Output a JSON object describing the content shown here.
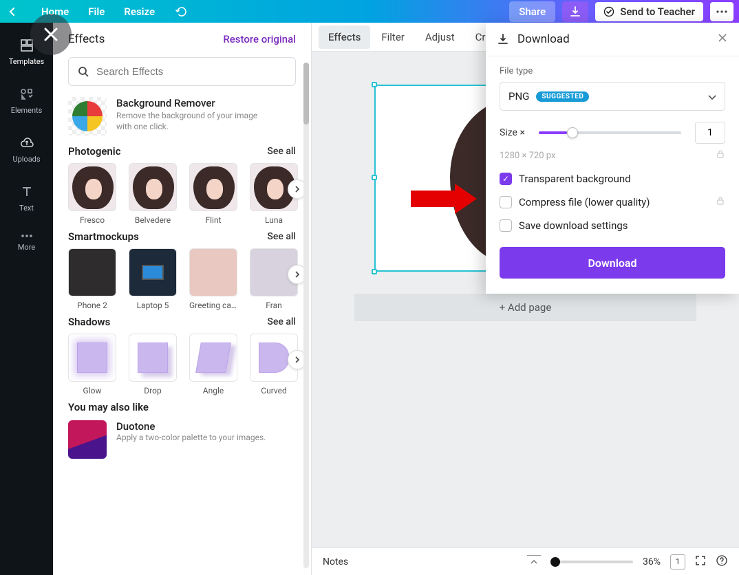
{
  "top": {
    "home": "Home",
    "file": "File",
    "resize": "Resize",
    "share": "Share",
    "send": "Send to Teacher"
  },
  "sidenav": [
    {
      "label": "Templates"
    },
    {
      "label": "Elements"
    },
    {
      "label": "Uploads"
    },
    {
      "label": "Text"
    },
    {
      "label": "More"
    }
  ],
  "panel": {
    "title": "Effects",
    "restore": "Restore original",
    "search_ph": "Search Effects",
    "bg_title": "Background Remover",
    "bg_desc": "Remove the background of your image with one click.",
    "seeall": "See all",
    "photogenic": {
      "title": "Photogenic",
      "items": [
        "Fresco",
        "Belvedere",
        "Flint",
        "Luna"
      ]
    },
    "smartmockups": {
      "title": "Smartmockups",
      "items": [
        "Phone 2",
        "Laptop 5",
        "Greeting car...",
        "Fran"
      ]
    },
    "shadows": {
      "title": "Shadows",
      "items": [
        "Glow",
        "Drop",
        "Angle",
        "Curved"
      ]
    },
    "yml_title": "You may also like",
    "duotone_title": "Duotone",
    "duotone_desc": "Apply a two-color palette to your images."
  },
  "tabs": [
    "Effects",
    "Filter",
    "Adjust",
    "Cr"
  ],
  "stage": {
    "add_page": "+ Add page"
  },
  "bottom": {
    "notes": "Notes",
    "zoom": "36%",
    "page": "1"
  },
  "download": {
    "title": "Download",
    "file_type_label": "File type",
    "file_type": "PNG",
    "suggested": "SUGGESTED",
    "size_label": "Size ×",
    "size_value": "1",
    "dims": "1280 × 720 px",
    "transparent": "Transparent background",
    "compress": "Compress file (lower quality)",
    "save": "Save download settings",
    "button": "Download"
  }
}
